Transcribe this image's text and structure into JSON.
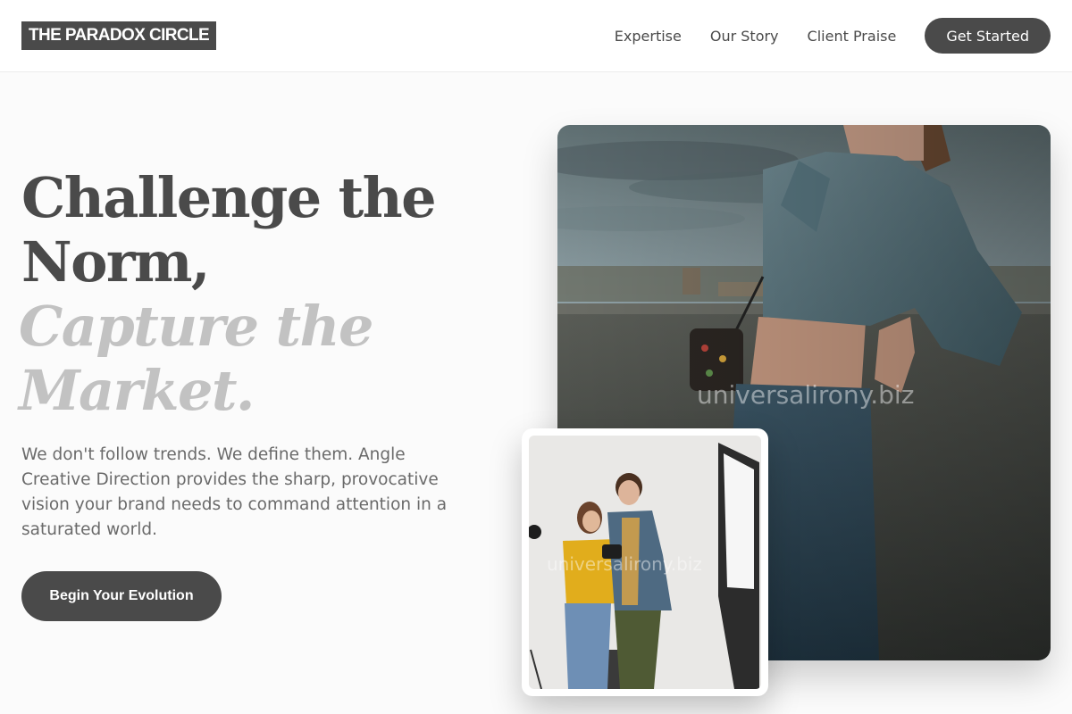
{
  "header": {
    "logo": "THE PARADOX CIRCLE",
    "nav": [
      "Expertise",
      "Our Story",
      "Client Praise"
    ],
    "cta": "Get Started"
  },
  "hero": {
    "headline_line1": "Challenge the",
    "headline_line2": "Norm,",
    "accent_line1": "Capture the",
    "accent_line2": "Market.",
    "subcopy": "We don't follow trends. We define them. Angle Creative Direction provides the sharp, provocative vision your brand needs to command attention in a saturated world.",
    "cta": "Begin Your Evolution"
  },
  "images": {
    "main_photo_desc": "woman-in-denim-jacket-rooftop",
    "small_photo_desc": "two-people-reviewing-camera-in-studio",
    "watermark": "universalirony.biz"
  },
  "colors": {
    "primary": "#4a4a4a",
    "accent_text": "#c2c2c2",
    "background": "#fbfbfb"
  }
}
